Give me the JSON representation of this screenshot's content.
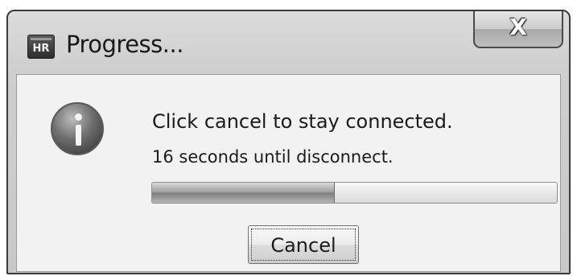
{
  "window": {
    "title": "Progress...",
    "app_icon": {
      "name": "hr-app-icon",
      "text": "HR"
    },
    "close": {
      "icon": "close-icon",
      "glyph": "X"
    }
  },
  "dialog": {
    "icon": "info-icon",
    "message": "Click cancel to stay connected.",
    "countdown": "16 seconds until disconnect.",
    "progress_fraction": 0.45,
    "cancel_label": "Cancel"
  }
}
